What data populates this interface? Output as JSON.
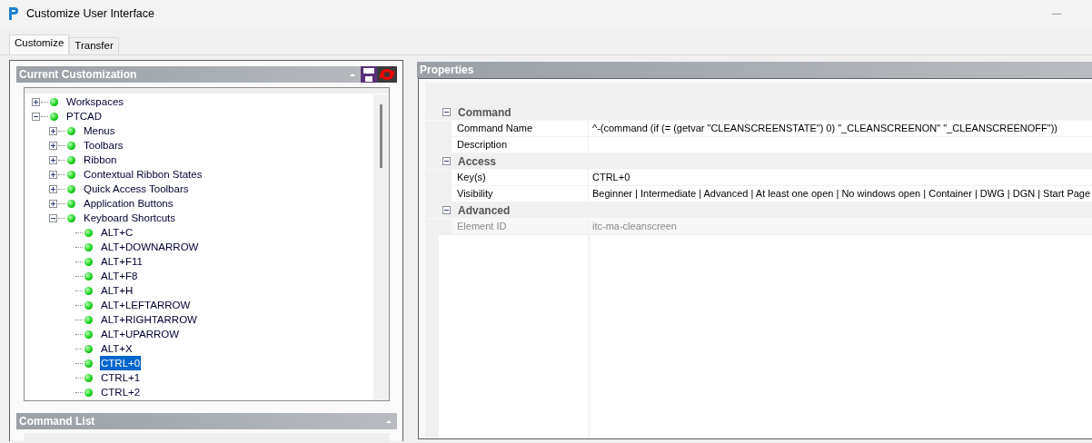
{
  "window": {
    "title": "Customize User Interface"
  },
  "tabs": [
    {
      "label": "Customize",
      "selected": true
    },
    {
      "label": "Transfer",
      "selected": false
    }
  ],
  "customization_panel": {
    "title": "Current Customization",
    "tree": [
      {
        "label": "Workspaces",
        "expanded": false,
        "selected": false
      },
      {
        "label": "PTCAD",
        "expanded": true,
        "selected": false,
        "children": [
          {
            "label": "Menus",
            "expanded": false,
            "selected": false
          },
          {
            "label": "Toolbars",
            "expanded": false,
            "selected": false
          },
          {
            "label": "Ribbon",
            "expanded": false,
            "selected": false
          },
          {
            "label": "Contextual Ribbon States",
            "expanded": false,
            "selected": false
          },
          {
            "label": "Quick Access Toolbars",
            "expanded": false,
            "selected": false
          },
          {
            "label": "Application Buttons",
            "expanded": false,
            "selected": false
          },
          {
            "label": "Keyboard Shortcuts",
            "expanded": true,
            "selected": false,
            "children": [
              {
                "label": "ALT+C",
                "selected": false
              },
              {
                "label": "ALT+DOWNARROW",
                "selected": false
              },
              {
                "label": "ALT+F11",
                "selected": false
              },
              {
                "label": "ALT+F8",
                "selected": false
              },
              {
                "label": "ALT+H",
                "selected": false
              },
              {
                "label": "ALT+LEFTARROW",
                "selected": false
              },
              {
                "label": "ALT+RIGHTARROW",
                "selected": false
              },
              {
                "label": "ALT+UPARROW",
                "selected": false
              },
              {
                "label": "ALT+X",
                "selected": false
              },
              {
                "label": "CTRL+0",
                "selected": true
              },
              {
                "label": "CTRL+1",
                "selected": false
              },
              {
                "label": "CTRL+2",
                "selected": false
              }
            ]
          }
        ]
      }
    ]
  },
  "command_list_panel": {
    "title": "Command List"
  },
  "properties_panel": {
    "title": "Properties",
    "categories": [
      {
        "name": "Command",
        "expanded": true,
        "rows": [
          {
            "name": "Command Name",
            "value": "^-(command (if (= (getvar \"CLEANSCREENSTATE\") 0) \"_CLEANSCREENON\" \"_CLEANSCREENOFF\"))",
            "disabled": false
          },
          {
            "name": "Description",
            "value": "",
            "disabled": false
          }
        ]
      },
      {
        "name": "Access",
        "expanded": true,
        "rows": [
          {
            "name": "Key(s)",
            "value": "CTRL+0",
            "disabled": false
          },
          {
            "name": "Visibility",
            "value": "Beginner | Intermediate | Advanced | At least one open | No windows open | Container | DWG | DGN | Start Page",
            "disabled": false
          }
        ]
      },
      {
        "name": "Advanced",
        "expanded": true,
        "rows": [
          {
            "name": "Element ID",
            "value": "itc-ma-cleanscreen",
            "disabled": true
          }
        ]
      }
    ]
  }
}
